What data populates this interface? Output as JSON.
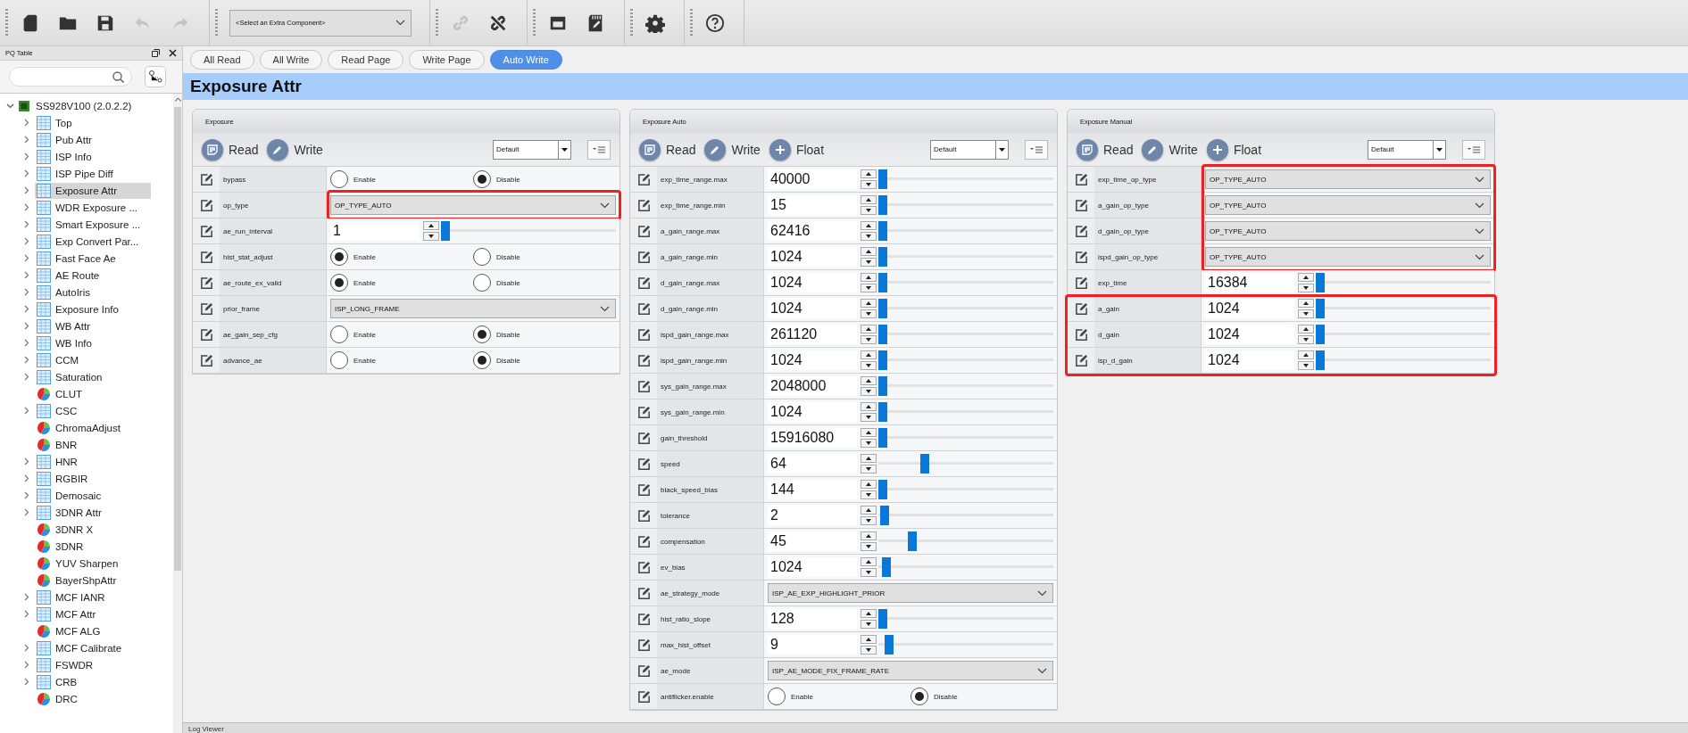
{
  "toolbar": {
    "groups": [
      {
        "items": [
          {
            "disabled": false
          },
          {
            "disabled": false
          },
          {
            "disabled": false
          },
          {
            "disabled": true
          },
          {
            "disabled": true
          }
        ]
      },
      {
        "select": "<Select an Extra Component>"
      },
      {
        "items": [
          {
            "disabled": true
          },
          {
            "disabled": false
          }
        ]
      },
      {
        "items": [
          {
            "disabled": false
          },
          {
            "disabled": false
          }
        ]
      },
      {
        "items": [
          {
            "disabled": false
          }
        ]
      },
      {
        "items": [
          {
            "disabled": false
          }
        ]
      }
    ]
  },
  "sidebar": {
    "title": "PQ Table",
    "tree": {
      "label": "SS928V100 (2.0.2.2)",
      "expanded": true,
      "children": [
        {
          "label": "Top",
          "kind": "table",
          "selected": false
        },
        {
          "label": "Pub Attr",
          "kind": "table",
          "selected": false
        },
        {
          "label": "ISP Info",
          "kind": "table",
          "selected": false
        },
        {
          "label": "ISP Pipe Diff",
          "kind": "table",
          "selected": false
        },
        {
          "label": "Exposure Attr",
          "kind": "table",
          "selected": true
        },
        {
          "label": "WDR Exposure ...",
          "kind": "table",
          "selected": false
        },
        {
          "label": "Smart Exposure ...",
          "kind": "table",
          "selected": false
        },
        {
          "label": "Exp Convert Par...",
          "kind": "table",
          "selected": false
        },
        {
          "label": "Fast Face Ae",
          "kind": "table",
          "selected": false
        },
        {
          "label": "AE Route",
          "kind": "table",
          "selected": false
        },
        {
          "label": "AutoIris",
          "kind": "table",
          "selected": false
        },
        {
          "label": "Exposure Info",
          "kind": "table",
          "selected": false
        },
        {
          "label": "WB Attr",
          "kind": "table",
          "selected": false
        },
        {
          "label": "WB Info",
          "kind": "table",
          "selected": false
        },
        {
          "label": "CCM",
          "kind": "table",
          "selected": false
        },
        {
          "label": "Saturation",
          "kind": "table",
          "selected": false
        },
        {
          "label": "CLUT",
          "kind": "chart",
          "selected": false
        },
        {
          "label": "CSC",
          "kind": "table",
          "selected": false
        },
        {
          "label": "ChromaAdjust",
          "kind": "chart",
          "selected": false
        },
        {
          "label": "BNR",
          "kind": "chart",
          "selected": false
        },
        {
          "label": "HNR",
          "kind": "table",
          "selected": false
        },
        {
          "label": "RGBIR",
          "kind": "table",
          "selected": false
        },
        {
          "label": "Demosaic",
          "kind": "table",
          "selected": false
        },
        {
          "label": "3DNR Attr",
          "kind": "table",
          "selected": false
        },
        {
          "label": "3DNR X",
          "kind": "chart",
          "selected": false
        },
        {
          "label": "3DNR",
          "kind": "chart",
          "selected": false
        },
        {
          "label": "YUV Sharpen",
          "kind": "chart",
          "selected": false
        },
        {
          "label": "BayerShpAttr",
          "kind": "chart",
          "selected": false
        },
        {
          "label": "MCF IANR",
          "kind": "table",
          "selected": false
        },
        {
          "label": "MCF Attr",
          "kind": "table",
          "selected": false
        },
        {
          "label": "MCF ALG",
          "kind": "chart",
          "selected": false
        },
        {
          "label": "MCF Calibrate",
          "kind": "table",
          "selected": false
        },
        {
          "label": "FSWDR",
          "kind": "table",
          "selected": false
        },
        {
          "label": "CRB",
          "kind": "table",
          "selected": false
        },
        {
          "label": "DRC",
          "kind": "chart",
          "selected": false
        }
      ]
    }
  },
  "actions": [
    {
      "label": "All Read",
      "selected": false
    },
    {
      "label": "All Write",
      "selected": false
    },
    {
      "label": "Read Page",
      "selected": false
    },
    {
      "label": "Write Page",
      "selected": false
    },
    {
      "label": "Auto Write",
      "selected": true
    }
  ],
  "page_title": "Exposure Attr",
  "panels": [
    {
      "title": "Exposure",
      "buttons": [
        {
          "kind": "read",
          "label": "Read"
        },
        {
          "kind": "write",
          "label": "Write"
        }
      ],
      "preset": "Default",
      "rows": [
        {
          "label": "bypass",
          "kind": "radio",
          "options": [
            {
              "label": "Enable",
              "selected": false
            },
            {
              "label": "Disable",
              "selected": true
            }
          ]
        },
        {
          "label": "op_type",
          "kind": "select",
          "value": "OP_TYPE_AUTO",
          "highlight_control": true
        },
        {
          "label": "ae_run_interval",
          "kind": "number",
          "value": "1",
          "level": 0
        },
        {
          "label": "hist_stat_adjust",
          "kind": "radio",
          "options": [
            {
              "label": "Enable",
              "selected": true
            },
            {
              "label": "Disable",
              "selected": false
            }
          ]
        },
        {
          "label": "ae_route_ex_valid",
          "kind": "radio",
          "options": [
            {
              "label": "Enable",
              "selected": true
            },
            {
              "label": "Disable",
              "selected": false
            }
          ]
        },
        {
          "label": "prior_frame",
          "kind": "select",
          "value": "ISP_LONG_FRAME"
        },
        {
          "label": "ae_gain_sep_cfg",
          "kind": "radio",
          "options": [
            {
              "label": "Enable",
              "selected": false
            },
            {
              "label": "Disable",
              "selected": true
            }
          ]
        },
        {
          "label": "advance_ae",
          "kind": "radio",
          "options": [
            {
              "label": "Enable",
              "selected": false
            },
            {
              "label": "Disable",
              "selected": true
            }
          ]
        }
      ]
    },
    {
      "title": "Exposure Auto",
      "buttons": [
        {
          "kind": "read",
          "label": "Read"
        },
        {
          "kind": "write",
          "label": "Write"
        },
        {
          "kind": "float",
          "label": "Float"
        }
      ],
      "preset": "Default",
      "rows": [
        {
          "label": "exp_time_range.max",
          "kind": "number",
          "value": "40000",
          "level": 0
        },
        {
          "label": "exp_time_range.min",
          "kind": "number",
          "value": "15",
          "level": 0
        },
        {
          "label": "a_gain_range.max",
          "kind": "number",
          "value": "62416",
          "level": 0
        },
        {
          "label": "a_gain_range.min",
          "kind": "number",
          "value": "1024",
          "level": 0
        },
        {
          "label": "d_gain_range.max",
          "kind": "number",
          "value": "1024",
          "level": 0
        },
        {
          "label": "d_gain_range.min",
          "kind": "number",
          "value": "1024",
          "level": 0
        },
        {
          "label": "ispd_gain_range.max",
          "kind": "number",
          "value": "261120",
          "level": 0
        },
        {
          "label": "ispd_gain_range.min",
          "kind": "number",
          "value": "1024",
          "level": 0
        },
        {
          "label": "sys_gain_range.max",
          "kind": "number",
          "value": "2048000",
          "level": 0
        },
        {
          "label": "sys_gain_range.min",
          "kind": "number",
          "value": "1024",
          "level": 0
        },
        {
          "label": "gain_threshold",
          "kind": "number",
          "value": "15916080",
          "level": 0
        },
        {
          "label": "speed",
          "kind": "number",
          "value": "64",
          "level": 0.25
        },
        {
          "label": "black_speed_bias",
          "kind": "number",
          "value": "144",
          "level": 0
        },
        {
          "label": "tolerance",
          "kind": "number",
          "value": "2",
          "level": 0.01
        },
        {
          "label": "compensation",
          "kind": "number",
          "value": "45",
          "level": 0.18
        },
        {
          "label": "ev_bias",
          "kind": "number",
          "value": "1024",
          "level": 0.02
        },
        {
          "label": "ae_strategy_mode",
          "kind": "select",
          "value": "ISP_AE_EXP_HIGHLIGHT_PRIOR"
        },
        {
          "label": "hist_ratio_slope",
          "kind": "number",
          "value": "128",
          "level": 0
        },
        {
          "label": "max_hist_offset",
          "kind": "number",
          "value": "9",
          "level": 0.04
        },
        {
          "label": "ae_mode",
          "kind": "select",
          "value": "ISP_AE_MODE_FIX_FRAME_RATE"
        },
        {
          "label": "antiflicker.enable",
          "kind": "radio",
          "options": [
            {
              "label": "Enable",
              "selected": false
            },
            {
              "label": "Disable",
              "selected": true
            }
          ]
        }
      ]
    },
    {
      "title": "Exposure Manual",
      "buttons": [
        {
          "kind": "read",
          "label": "Read"
        },
        {
          "kind": "write",
          "label": "Write"
        },
        {
          "kind": "float",
          "label": "Float"
        }
      ],
      "preset": "Default",
      "rows": [
        {
          "label": "exp_time_op_type",
          "kind": "select",
          "value": "OP_TYPE_AUTO",
          "highlight_control": true
        },
        {
          "label": "a_gain_op_type",
          "kind": "select",
          "value": "OP_TYPE_AUTO",
          "highlight_control": true
        },
        {
          "label": "d_gain_op_type",
          "kind": "select",
          "value": "OP_TYPE_AUTO",
          "highlight_control": true
        },
        {
          "label": "ispd_gain_op_type",
          "kind": "select",
          "value": "OP_TYPE_AUTO",
          "highlight_control": true
        },
        {
          "label": "exp_time",
          "kind": "number",
          "value": "16384",
          "level": 0
        },
        {
          "label": "a_gain",
          "kind": "number",
          "value": "1024",
          "level": 0,
          "highlight_row": true
        },
        {
          "label": "d_gain",
          "kind": "number",
          "value": "1024",
          "level": 0,
          "highlight_row": true
        },
        {
          "label": "isp_d_gain",
          "kind": "number",
          "value": "1024",
          "level": 0,
          "highlight_row": true
        }
      ]
    }
  ],
  "log_viewer": {
    "title": "Log Viewer"
  }
}
